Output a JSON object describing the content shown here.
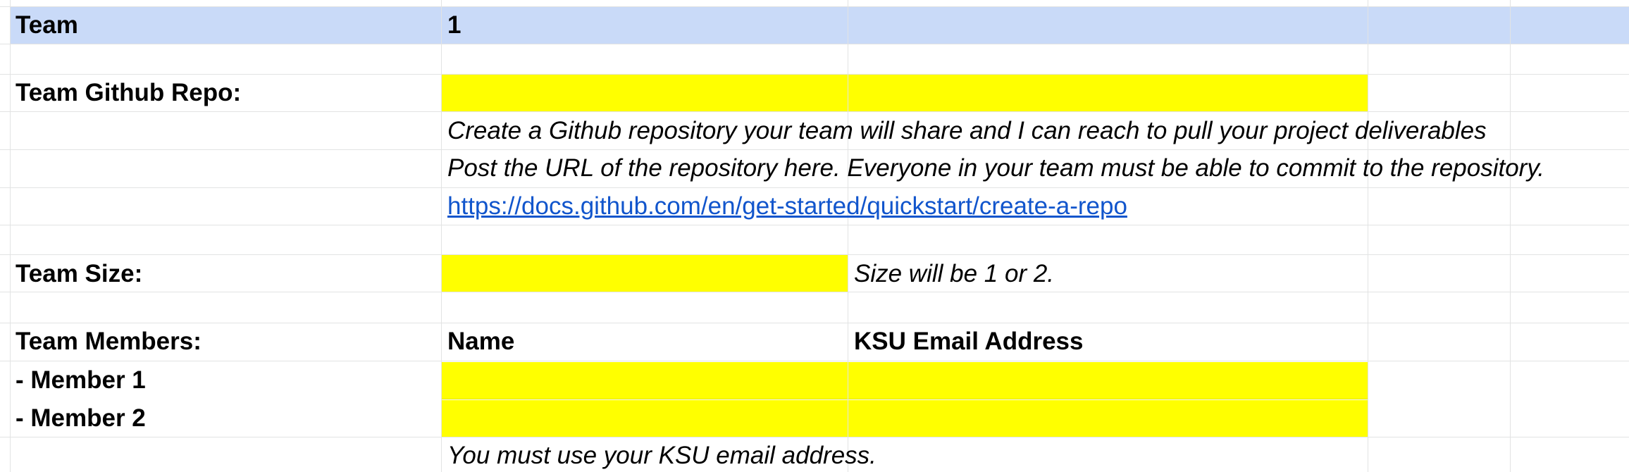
{
  "header": {
    "label": "Team",
    "value": "1"
  },
  "repo": {
    "label": "Team Github Repo:",
    "value": "",
    "note_line1": "Create a Github repository your team will share and I can reach to pull your project deliverables",
    "note_line2": "Post the URL of the repository here. Everyone in your team must be able to commit to the repository.",
    "help_link": "https://docs.github.com/en/get-started/quickstart/create-a-repo"
  },
  "size": {
    "label": "Team Size:",
    "value": "",
    "note": "Size will be 1 or 2."
  },
  "members": {
    "label": "Team Members:",
    "name_header": "Name",
    "email_header": "KSU Email Address",
    "rows": [
      {
        "label": "- Member 1",
        "name": "",
        "email": ""
      },
      {
        "label": "- Member 2",
        "name": "",
        "email": ""
      }
    ],
    "note": "You must use your KSU email address."
  },
  "colors": {
    "header_fill": "#c9daf8",
    "input_fill": "#ffff00",
    "link": "#1155cc",
    "gridline": "#e2e3e3"
  }
}
